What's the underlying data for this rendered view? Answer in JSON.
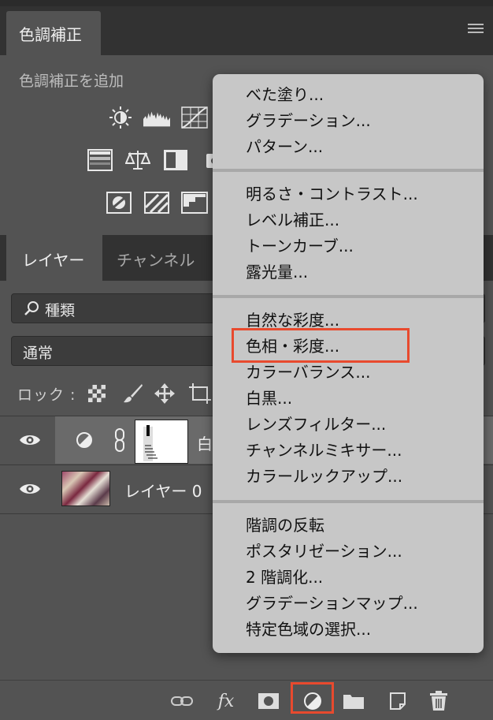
{
  "adjustments_panel": {
    "tab_label": "色調補正",
    "add_label": "色調補正を追加",
    "icons_row1": [
      "brightness-contrast-icon",
      "levels-icon",
      "curves-icon"
    ],
    "icons_row2": [
      "exposure-icon",
      "color-balance-icon",
      "black-white-icon",
      "camera-icon"
    ],
    "icons_row3": [
      "invert-icon",
      "gradient-map-icon",
      "posterize-icon"
    ]
  },
  "layers_panel": {
    "tabs": [
      {
        "label": "レイヤー",
        "active": true
      },
      {
        "label": "チャンネル",
        "active": false
      }
    ],
    "filter_label": "種類",
    "blend_mode": "通常",
    "lock_label": "ロック :",
    "layers": [
      {
        "name": "白",
        "type": "adjustment",
        "selected": true
      },
      {
        "name": "レイヤー 0",
        "type": "image",
        "selected": false
      }
    ]
  },
  "adjustment_menu": {
    "groups": [
      [
        "べた塗り...",
        "グラデーション...",
        "パターン..."
      ],
      [
        "明るさ・コントラスト...",
        "レベル補正...",
        "トーンカーブ...",
        "露光量..."
      ],
      [
        "自然な彩度...",
        "色相・彩度...",
        "カラーバランス...",
        "白黒...",
        "レンズフィルター...",
        "チャンネルミキサー...",
        "カラールックアップ..."
      ],
      [
        "階調の反転",
        "ポスタリゼーション...",
        "2 階調化...",
        "グラデーションマップ...",
        "特定色域の選択..."
      ]
    ],
    "highlighted_item": "色相・彩度..."
  },
  "bottom_bar": {
    "icons": [
      "link-icon",
      "fx-icon",
      "mask-icon",
      "adjustment-layer-icon",
      "folder-icon",
      "new-layer-icon",
      "trash-icon"
    ],
    "fx_label": "fx",
    "highlighted": "adjustment-layer-icon"
  },
  "colors": {
    "highlight": "#e84a2e",
    "menu_bg": "#c7c7c7",
    "panel_bg": "#535353"
  }
}
